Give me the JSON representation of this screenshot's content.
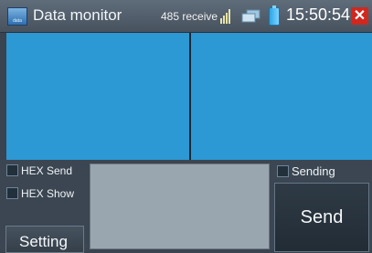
{
  "titlebar": {
    "app_icon_label": "data",
    "title": "Data monitor",
    "status_text": "485 receive",
    "clock": "15:50:54",
    "close_glyph": "✕",
    "icons": [
      "data-app-icon",
      "signal-icon",
      "network-icon",
      "battery-icon",
      "close-icon"
    ]
  },
  "options": {
    "hex_send": {
      "label": "HEX Send",
      "checked": false
    },
    "hex_show": {
      "label": "HEX Show",
      "checked": false
    },
    "sending": {
      "label": "Sending",
      "checked": false
    }
  },
  "buttons": {
    "setting": "Setting",
    "send": "Send"
  },
  "colors": {
    "panel": "#2c98d4",
    "titlebar": "#55616e",
    "close": "#d0281f"
  }
}
